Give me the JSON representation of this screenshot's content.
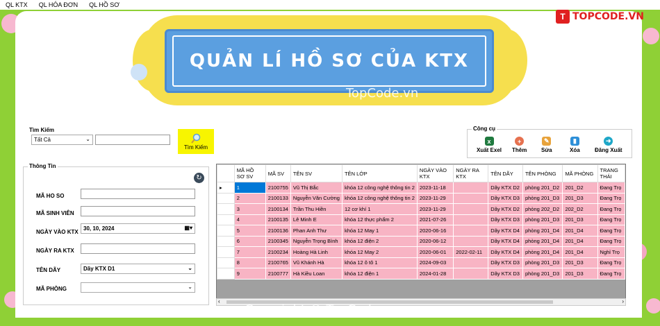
{
  "menu": [
    "QL KTX",
    "QL HÓA ĐƠN",
    "QL HỒ SƠ"
  ],
  "banner_title": "QUẢN LÍ HỒ SƠ CỦA KTX",
  "watermark_top": "TopCode.vn",
  "watermark_bottom": "Copyright © TopCode.vn",
  "logo": {
    "mark": "T",
    "text": "TOPCODE.VN"
  },
  "search": {
    "group_label": "Tìm Kiếm",
    "filter_value": "Tất Cả",
    "query": "",
    "button_label": "Tìm Kiếm"
  },
  "tools": {
    "group_label": "Công cụ",
    "export": "Xuất Exel",
    "add": "Thêm",
    "edit": "Sửa",
    "delete": "Xóa",
    "logout": "Đăng Xuất"
  },
  "info": {
    "group_label": "Thông Tin",
    "ma_ho_so_label": "MÃ HO SO",
    "ma_ho_so": "",
    "ma_sv_label": "MÃ SINH VIÊN",
    "ma_sv": "",
    "ngay_vao_label": "NGÀY VÀO KTX",
    "ngay_vao": "30, 10, 2024",
    "ngay_ra_label": "NGÀY RA KTX",
    "ngay_ra": "",
    "ten_day_label": "TÊN DÃY",
    "ten_day": "Dãy KTX D1",
    "ma_phong_label": "MÃ PHÒNG",
    "ma_phong": ""
  },
  "table": {
    "headers": [
      "MÃ HỒ SƠ SV",
      "MÃ SV",
      "TÊN SV",
      "TÊN LỚP",
      "NGÀY VÀO KTX",
      "NGÀY RA KTX",
      "TÊN DÃY",
      "TÊN PHÒNG",
      "MÃ PHÒNG",
      "TRANG THÁI"
    ],
    "rows": [
      [
        "1",
        "2100755",
        "Vũ Thị Bắc",
        "khóa 12 công nghệ thông tin 2",
        "2023-11-18",
        "",
        "Dãy KTX D2",
        "phòng 201_D2",
        "201_D2",
        "Đang Trọ"
      ],
      [
        "2",
        "2100133",
        "Nguyễn Văn Cường",
        "khóa 12 công nghệ thông tin 2",
        "2023-11-29",
        "",
        "Dãy KTX D3",
        "phòng 201_D3",
        "201_D3",
        "Đang Trọ"
      ],
      [
        "3",
        "2100134",
        "Trần Thu Hiền",
        "12 cơ khí 1",
        "2023-11-29",
        "",
        "Dãy KTX D2",
        "phòng 202_D2",
        "202_D2",
        "Đang Trọ"
      ],
      [
        "4",
        "2100135",
        "Lê Minh E",
        "khóa 12 thực phẩm 2",
        "2021-07-26",
        "",
        "Dãy KTX D3",
        "phòng 201_D3",
        "201_D3",
        "Đang Trọ"
      ],
      [
        "5",
        "2100136",
        "Phan Anh Thư",
        "khóa 12 May 1",
        "2020-06-16",
        "",
        "Dãy KTX D4",
        "phòng 201_D4",
        "201_D4",
        "Đang Trọ"
      ],
      [
        "6",
        "2100345",
        "Nguyễn Trọng Bình",
        "khóa 12 điện 2",
        "2020-06-12",
        "",
        "Dãy KTX D4",
        "phòng 201_D4",
        "201_D4",
        "Đang Trọ"
      ],
      [
        "7",
        "2100234",
        "Hoàng Hà Linh",
        "khóa 12 May 2",
        "2020-06-01",
        "2022-02-11",
        "Dãy KTX D4",
        "phòng 201_D4",
        "201_D4",
        "Nghỉ Trọ"
      ],
      [
        "8",
        "2100765",
        "Vũ Khánh Hà",
        "khóa 12 ô tô 1",
        "2024-09-03",
        "",
        "Dãy KTX D3",
        "phòng 201_D3",
        "201_D3",
        "Đang Trọ"
      ],
      [
        "9",
        "2100777",
        "Hà Kiều Loan",
        "khóa 12 điện 1",
        "2024-01-28",
        "",
        "Dãy KTX D3",
        "phòng 201_D3",
        "201_D3",
        "Đang Trọ"
      ]
    ]
  },
  "colors": {
    "background": "#8fd036",
    "row": "#f8b4c4",
    "selected": "#0078d7",
    "banner": "#5b9fe0",
    "cloud": "#f6df4e"
  }
}
